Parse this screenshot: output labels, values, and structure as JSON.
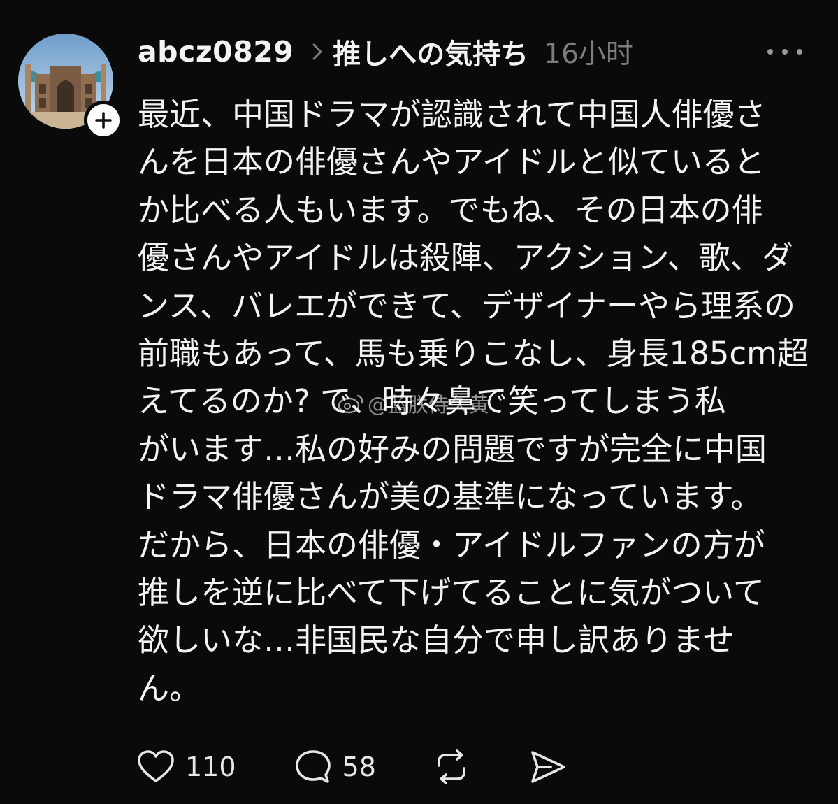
{
  "post": {
    "username": "abcz0829",
    "topic": "推しへの気持ち",
    "time": "16小时",
    "body_lines": [
      "最近、中国ドラマが認識されて中国人俳優さ",
      "んを日本の俳優さんやアイドルと似ていると",
      "か比べる人もいます。でもね、その日本の俳",
      "優さんやアイドルは殺陣、アクション、歌、ダ",
      "ンス、バレエができて、デザイナーやら理系の",
      "前職もあって、馬も乗りこなし、身長185cm超",
      "えてるのか? で、時々鼻で笑ってしまう私",
      "がいます…私の好みの問題ですが完全に中国",
      "ドラマ俳優さんが美の基準になっています。",
      "だから、日本の俳優・アイドルファンの方が",
      "推しを逆に比べて下げてることに気がついて",
      "欲しいな…非国民な自分で申し訳ありませ",
      "ん。"
    ],
    "watermark": "@蓝朕侍久黄",
    "likes": "110",
    "replies": "58"
  },
  "icons": {
    "follow": "plus-icon",
    "more": "more-horizontal-icon",
    "chevron": "chevron-right-icon",
    "like": "heart-icon",
    "reply": "comment-icon",
    "repost": "repost-icon",
    "share": "send-icon",
    "watermark": "weibo-icon"
  },
  "colors": {
    "background": "#0a0a0a",
    "text": "#f3f3f3",
    "muted": "#7d7d7d"
  }
}
